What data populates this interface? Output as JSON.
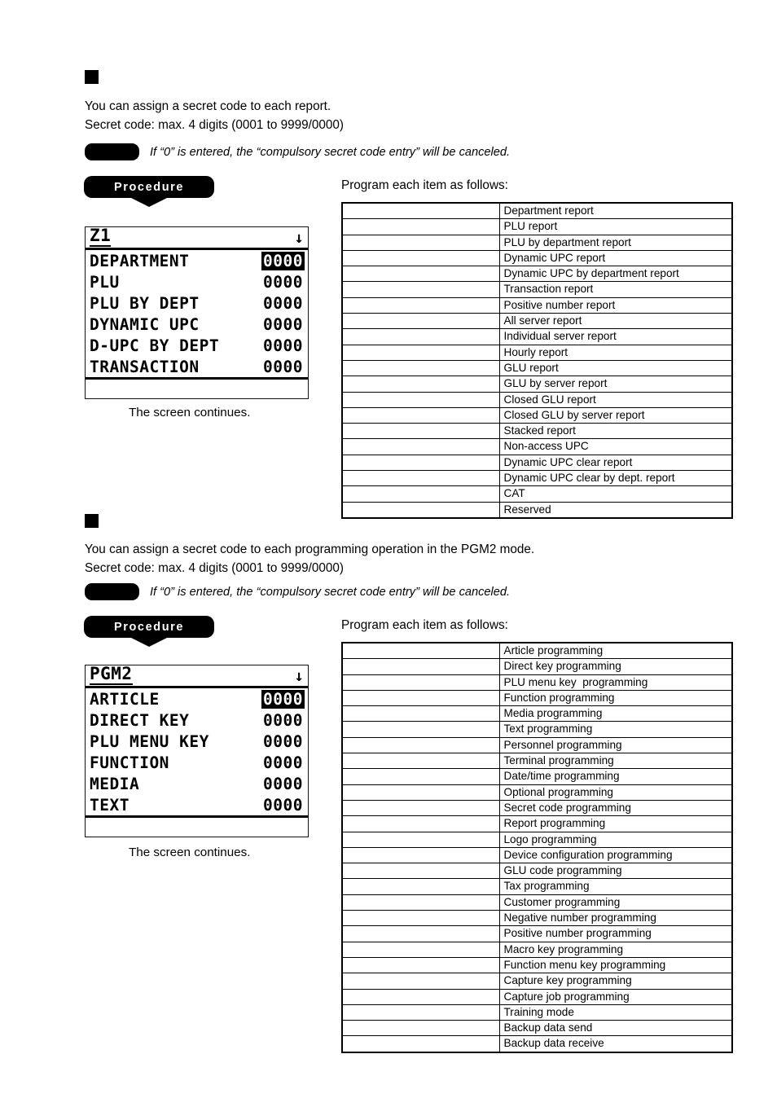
{
  "doc": {
    "note_icon": "black-rounded-pill",
    "bullet_icon": "black-square",
    "caption": "The screen continues.",
    "program_lead": "Program each item as follows:",
    "procedure_label": "Procedure"
  },
  "section1": {
    "heading": "",
    "line1": "You can assign a secret code to each report.",
    "line2": "Secret code: max. 4 digits (0001 to 9999/0000)",
    "note": "If “0” is entered, the “compulsory secret code entry” will be canceled.",
    "lcd": {
      "title": "Z1",
      "scroll_indicator": "↓",
      "rows": [
        {
          "label": "DEPARTMENT",
          "value": "0000",
          "selected": true
        },
        {
          "label": "PLU",
          "value": "0000",
          "selected": false
        },
        {
          "label": "PLU BY DEPT",
          "value": "0000",
          "selected": false
        },
        {
          "label": "DYNAMIC UPC",
          "value": "0000",
          "selected": false
        },
        {
          "label": "D-UPC BY DEPT",
          "value": "0000",
          "selected": false
        },
        {
          "label": "TRANSACTION",
          "value": "0000",
          "selected": false
        }
      ],
      "status": ""
    },
    "table": {
      "rows": [
        {
          "left": "",
          "right": "Department report"
        },
        {
          "left": "",
          "right": "PLU report"
        },
        {
          "left": "",
          "right": "PLU by department report"
        },
        {
          "left": "",
          "right": "Dynamic UPC report"
        },
        {
          "left": "",
          "right": "Dynamic UPC by department report"
        },
        {
          "left": "",
          "right": "Transaction report"
        },
        {
          "left": "",
          "right": "Positive number report"
        },
        {
          "left": "",
          "right": "All server report"
        },
        {
          "left": "",
          "right": "Individual server report"
        },
        {
          "left": "",
          "right": "Hourly report"
        },
        {
          "left": "",
          "right": "GLU report"
        },
        {
          "left": "",
          "right": "GLU by server report"
        },
        {
          "left": "",
          "right": "Closed GLU report"
        },
        {
          "left": "",
          "right": "Closed GLU by server report"
        },
        {
          "left": "",
          "right": "Stacked report"
        },
        {
          "left": "",
          "right": "Non-access UPC"
        },
        {
          "left": "",
          "right": "Dynamic UPC clear report"
        },
        {
          "left": "",
          "right": "Dynamic UPC clear by dept. report"
        },
        {
          "left": "",
          "right": "CAT"
        },
        {
          "left": "",
          "right": "Reserved"
        }
      ]
    }
  },
  "section2": {
    "heading": "",
    "line1": "You can assign a secret code to each programming operation in the PGM2 mode.",
    "line2": "Secret code: max. 4 digits (0001 to 9999/0000)",
    "note": "If “0” is entered, the “compulsory secret code entry” will be canceled.",
    "lcd": {
      "title": "PGM2",
      "scroll_indicator": "↓",
      "rows": [
        {
          "label": "ARTICLE",
          "value": "0000",
          "selected": true
        },
        {
          "label": "DIRECT KEY",
          "value": "0000",
          "selected": false
        },
        {
          "label": "PLU MENU KEY",
          "value": "0000",
          "selected": false
        },
        {
          "label": "FUNCTION",
          "value": "0000",
          "selected": false
        },
        {
          "label": "MEDIA",
          "value": "0000",
          "selected": false
        },
        {
          "label": "TEXT",
          "value": "0000",
          "selected": false
        }
      ],
      "status": ""
    },
    "table": {
      "rows": [
        {
          "left": "",
          "right": "Article programming"
        },
        {
          "left": "",
          "right": "Direct key programming"
        },
        {
          "left": "",
          "right": "PLU menu key  programming"
        },
        {
          "left": "",
          "right": "Function programming"
        },
        {
          "left": "",
          "right": "Media programming"
        },
        {
          "left": "",
          "right": "Text programming"
        },
        {
          "left": "",
          "right": "Personnel programming"
        },
        {
          "left": "",
          "right": "Terminal programming"
        },
        {
          "left": "",
          "right": "Date/time programming"
        },
        {
          "left": "",
          "right": "Optional programming"
        },
        {
          "left": "",
          "right": "Secret code programming"
        },
        {
          "left": "",
          "right": "Report programming"
        },
        {
          "left": "",
          "right": "Logo programming"
        },
        {
          "left": "",
          "right": "Device configuration programming"
        },
        {
          "left": "",
          "right": "GLU code programming"
        },
        {
          "left": "",
          "right": "Tax programming"
        },
        {
          "left": "",
          "right": "Customer programming"
        },
        {
          "left": "",
          "right": "Negative number programming"
        },
        {
          "left": "",
          "right": "Positive number programming"
        },
        {
          "left": "",
          "right": "Macro key programming"
        },
        {
          "left": "",
          "right": "Function menu key programming"
        },
        {
          "left": "",
          "right": "Capture key programming"
        },
        {
          "left": "",
          "right": "Capture job programming"
        },
        {
          "left": "",
          "right": "Training mode"
        },
        {
          "left": "",
          "right": "Backup data send"
        },
        {
          "left": "",
          "right": "Backup data receive"
        }
      ]
    }
  }
}
